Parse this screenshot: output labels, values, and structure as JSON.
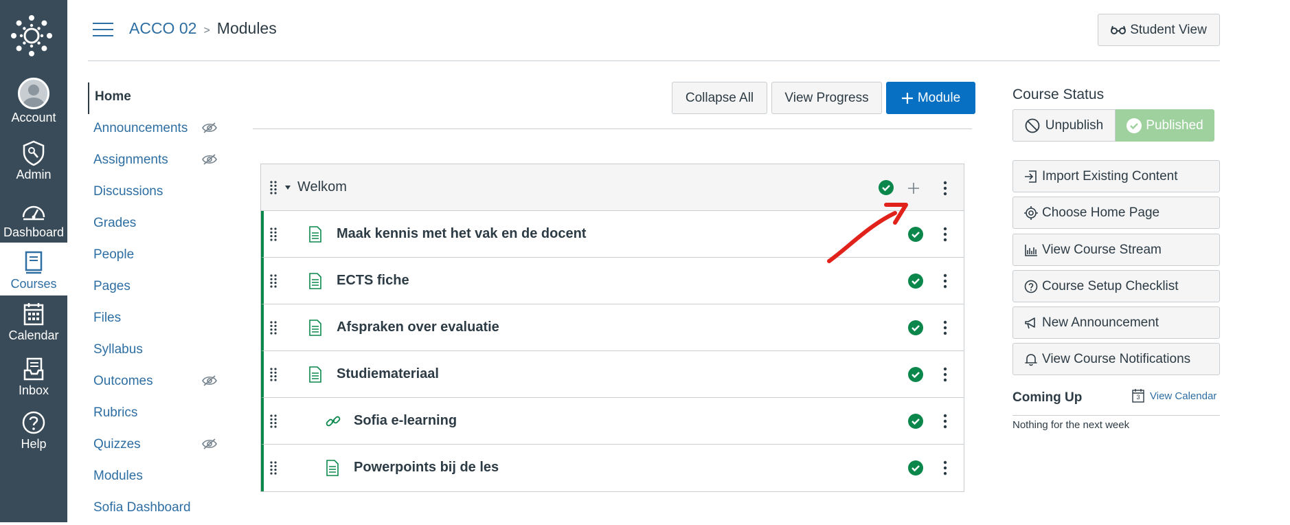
{
  "global_nav": {
    "items": [
      {
        "label": "Account",
        "icon": "account-avatar-icon"
      },
      {
        "label": "Admin",
        "icon": "admin-shield-icon"
      },
      {
        "label": "Dashboard",
        "icon": "dashboard-gauge-icon"
      },
      {
        "label": "Courses",
        "icon": "courses-book-icon",
        "active": true
      },
      {
        "label": "Calendar",
        "icon": "calendar-icon"
      },
      {
        "label": "Inbox",
        "icon": "inbox-icon"
      },
      {
        "label": "Help",
        "icon": "help-question-icon"
      }
    ]
  },
  "header": {
    "breadcrumb_course": "ACCO 02",
    "breadcrumb_separator": ">",
    "breadcrumb_page": "Modules",
    "student_view_label": "Student View"
  },
  "course_nav": {
    "items": [
      {
        "label": "Home",
        "hidden": false
      },
      {
        "label": "Announcements",
        "hidden": true
      },
      {
        "label": "Assignments",
        "hidden": true
      },
      {
        "label": "Discussions",
        "hidden": false
      },
      {
        "label": "Grades",
        "hidden": false
      },
      {
        "label": "People",
        "hidden": false
      },
      {
        "label": "Pages",
        "hidden": false
      },
      {
        "label": "Files",
        "hidden": false
      },
      {
        "label": "Syllabus",
        "hidden": false
      },
      {
        "label": "Outcomes",
        "hidden": true
      },
      {
        "label": "Rubrics",
        "hidden": false
      },
      {
        "label": "Quizzes",
        "hidden": true
      },
      {
        "label": "Modules",
        "hidden": false
      },
      {
        "label": "Sofia Dashboard",
        "hidden": false
      }
    ]
  },
  "toolbar": {
    "collapse_all_label": "Collapse All",
    "view_progress_label": "View Progress",
    "add_module_label": "Module"
  },
  "module": {
    "title": "Welkom",
    "items": [
      {
        "title": "Maak kennis met het vak en de docent",
        "type": "page"
      },
      {
        "title": "ECTS fiche",
        "type": "page"
      },
      {
        "title": "Afspraken over evaluatie",
        "type": "page"
      },
      {
        "title": "Studiemateriaal",
        "type": "page"
      },
      {
        "title": "Sofia e-learning",
        "type": "link",
        "indent": true
      },
      {
        "title": "Powerpoints bij de les",
        "type": "page",
        "indent": true
      }
    ]
  },
  "sidebar": {
    "course_status_label": "Course Status",
    "unpublish_label": "Unpublish",
    "published_label": "Published",
    "buttons": [
      {
        "label": "Import Existing Content",
        "icon": "import-icon"
      },
      {
        "label": "Choose Home Page",
        "icon": "target-icon"
      },
      {
        "label": "View Course Stream",
        "icon": "stream-chart-icon"
      },
      {
        "label": "Course Setup Checklist",
        "icon": "question-circle-icon"
      },
      {
        "label": "New Announcement",
        "icon": "megaphone-icon"
      },
      {
        "label": "View Course Notifications",
        "icon": "bell-icon"
      }
    ],
    "coming_up_label": "Coming Up",
    "view_calendar_label": "View Calendar",
    "calendar_icon_day": "3",
    "coming_up_empty": "Nothing for the next week"
  },
  "colors": {
    "nav_bg": "#394b58",
    "link": "#2d6ea3",
    "primary": "#0770c3",
    "success": "#0b874b",
    "published_bg": "#9ed19e",
    "annotation_arrow": "#e0221b"
  }
}
